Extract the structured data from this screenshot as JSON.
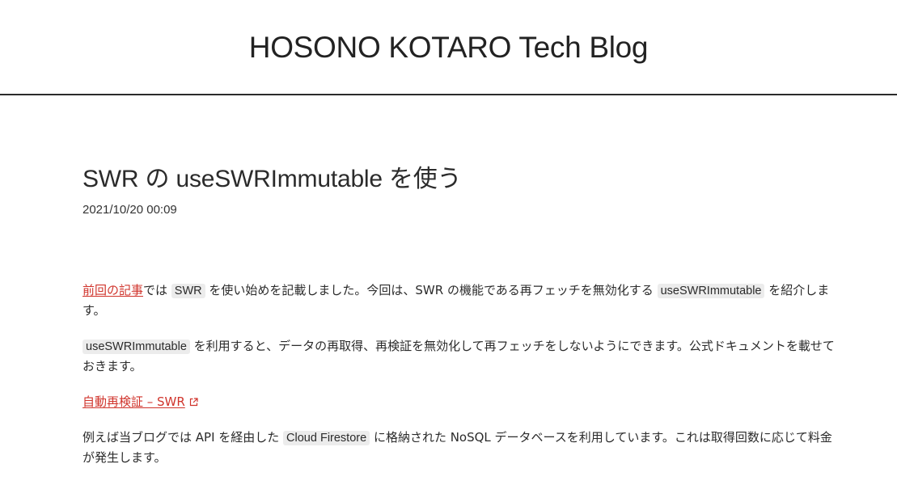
{
  "header": {
    "site_title": "HOSONO KOTARO Tech Blog"
  },
  "post": {
    "title": "SWR の useSWRImmutable を使う",
    "date": "2021/10/20 00:09",
    "p1": {
      "link_prev": "前回の記事",
      "t1": "では ",
      "code_swr": "SWR",
      "t2": " を使い始めを記載しました。今回は、SWR の機能である再フェッチを無効化する ",
      "code_immutable": "useSWRImmutable",
      "t3": " を紹介します。"
    },
    "p2": {
      "code_immutable": "useSWRImmutable",
      "t1": " を利用すると、データの再取得、再検証を無効化して再フェッチをしないようにできます。公式ドキュメントを載せておきます。"
    },
    "p3": {
      "link_doc": "自動再検証 – SWR",
      "icon": "external-link-icon"
    },
    "p4": {
      "t1": "例えば当ブログでは API を経由した ",
      "code_firestore": "Cloud Firestore",
      "t2": " に格納された NoSQL データベースを利用しています。これは取得回数に応じて料金が発生します。"
    },
    "accent_color": "#d0342c"
  }
}
